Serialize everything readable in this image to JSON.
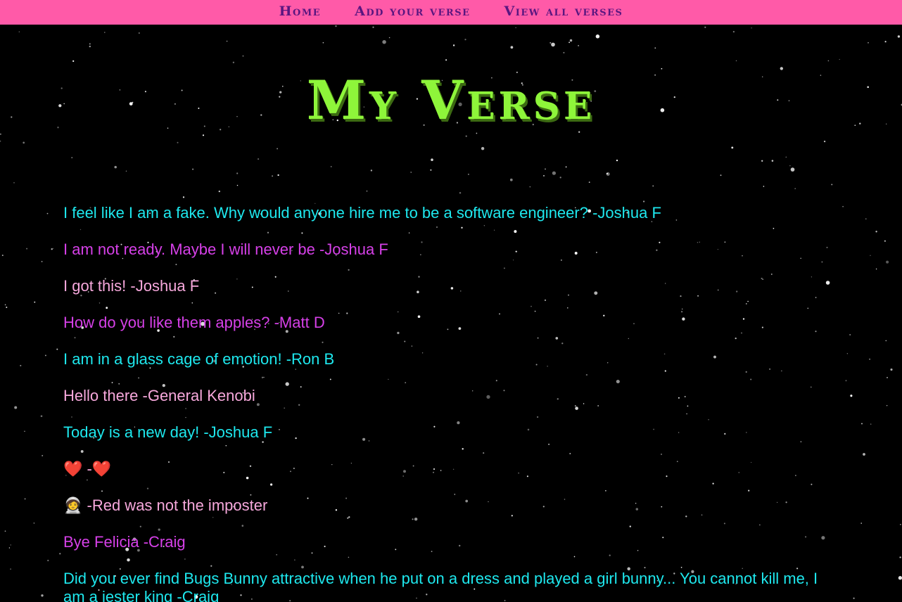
{
  "nav": {
    "items": [
      {
        "label": "Home"
      },
      {
        "label": "Add your verse"
      },
      {
        "label": "View all verses"
      }
    ]
  },
  "page": {
    "title": "My Verse"
  },
  "verses": [
    {
      "text": "I feel like I am a fake. Why would anyone hire me to be a software engineer? -Joshua F",
      "color": "#1ee8ee"
    },
    {
      "text": "I am not ready. Maybe I will never be -Joshua F",
      "color": "#d640e8"
    },
    {
      "text": "I got this! -Joshua F",
      "color": "#f7a8dc"
    },
    {
      "text": "How do you like them apples? -Matt D",
      "color": "#d640e8"
    },
    {
      "text": "I am in a glass cage of emotion! -Ron B",
      "color": "#1ee8ee"
    },
    {
      "text": "Hello there -General Kenobi",
      "color": "#f7a8dc"
    },
    {
      "text": "Today is a new day! -Joshua F",
      "color": "#1ee8ee"
    },
    {
      "text": "❤️ -❤️",
      "color": "#f7a8dc"
    },
    {
      "text": "🧑‍🚀 -Red was not the imposter",
      "color": "#f7a8dc"
    },
    {
      "text": "Bye Felicia -Craig",
      "color": "#d640e8"
    },
    {
      "text": "Did you ever find Bugs Bunny attractive when he put on a dress and played a girl bunny... You cannot kill me, I am a jester king -Craig",
      "color": "#1ee8ee"
    }
  ],
  "colors": {
    "nav_background": "#ff5aa8",
    "nav_text": "#5a1680",
    "title": "#8ef53a",
    "background": "#000000"
  }
}
